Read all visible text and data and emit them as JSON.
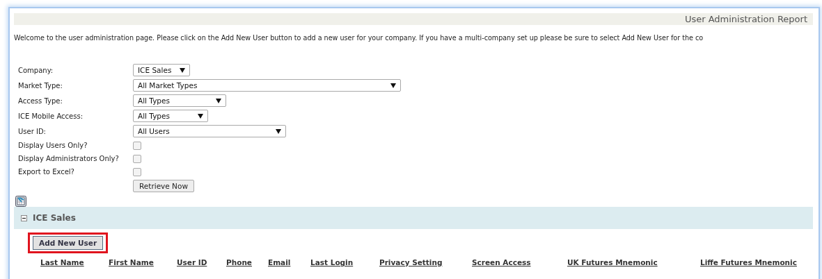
{
  "header": {
    "title": "User Administration Report"
  },
  "intro": "Welcome to the user administration page. Please click on the Add New User button to add a new user for your company. If you have a multi-company set up please be sure to select Add New User for the co",
  "filters": [
    {
      "kind": "select",
      "label": "Company:",
      "value": "ICE Sales"
    },
    {
      "kind": "select",
      "label": "Market Type:",
      "value": "All Market Types"
    },
    {
      "kind": "select",
      "label": "Access Type:",
      "value": "All Types"
    },
    {
      "kind": "select",
      "label": "ICE Mobile Access:",
      "value": "All Types"
    },
    {
      "kind": "select",
      "label": "User ID:",
      "value": "All Users"
    },
    {
      "kind": "checkbox",
      "label": "Display Users Only?",
      "checked": false
    },
    {
      "kind": "checkbox",
      "label": "Display Administrators Only?",
      "checked": false
    },
    {
      "kind": "checkbox",
      "label": "Export to Excel?",
      "checked": false
    }
  ],
  "retrieve_button": "Retrieve Now",
  "groups": [
    {
      "name": "ICE Sales",
      "expanded": true,
      "add_button": "Add New User",
      "add_button_highlighted": true,
      "columns": [
        "Last Name",
        "First Name",
        "User ID",
        "Phone",
        "Email",
        "Last Login",
        "Privacy Setting",
        "Screen Access",
        "UK Futures Mnemonic",
        "Liffe Futures Mnemonic"
      ]
    }
  ]
}
